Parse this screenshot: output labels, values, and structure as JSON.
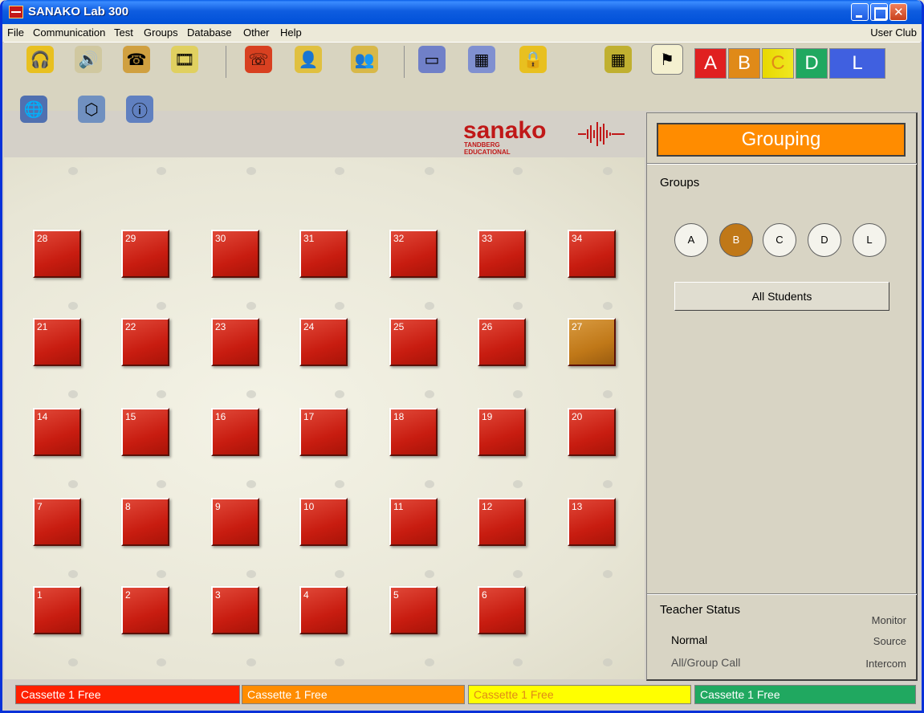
{
  "window": {
    "title": "SANAKO Lab 300"
  },
  "menu": {
    "items": [
      "File",
      "Communication",
      "Test",
      "Groups",
      "Database",
      "Other",
      "Help"
    ],
    "right": "User Club"
  },
  "toolbar": {
    "icons": [
      "headset-icon",
      "speaker-icon",
      "phone-icon",
      "film-icon",
      "telephone-icon",
      "student-icon",
      "students-group-icon",
      "monitor-icon",
      "calendar-icon",
      "lock-icon",
      "grid-icon",
      "grouping-icon"
    ],
    "secondary_icons": [
      "globe-icon",
      "box-icon",
      "info-window-icon"
    ],
    "group_tabs": [
      {
        "label": "A",
        "color": "#e02020"
      },
      {
        "label": "B",
        "color": "#e08a18"
      },
      {
        "label": "C",
        "color": "#e6e000"
      },
      {
        "label": "D",
        "color": "#20a860"
      },
      {
        "label": "L",
        "color": "#4060e0"
      }
    ]
  },
  "logo": {
    "brand": "sanako",
    "tagline": "TANDBERG EDUCATIONAL"
  },
  "seats": [
    {
      "n": "28",
      "group": "A"
    },
    {
      "n": "29",
      "group": "A"
    },
    {
      "n": "30",
      "group": "A"
    },
    {
      "n": "31",
      "group": "A"
    },
    {
      "n": "32",
      "group": "A"
    },
    {
      "n": "33",
      "group": "A"
    },
    {
      "n": "34",
      "group": "A"
    },
    {
      "n": "21",
      "group": "A"
    },
    {
      "n": "22",
      "group": "A"
    },
    {
      "n": "23",
      "group": "A"
    },
    {
      "n": "24",
      "group": "A"
    },
    {
      "n": "25",
      "group": "A"
    },
    {
      "n": "26",
      "group": "A"
    },
    {
      "n": "27",
      "group": "B"
    },
    {
      "n": "14",
      "group": "A"
    },
    {
      "n": "15",
      "group": "A"
    },
    {
      "n": "16",
      "group": "A"
    },
    {
      "n": "17",
      "group": "A"
    },
    {
      "n": "18",
      "group": "A"
    },
    {
      "n": "19",
      "group": "A"
    },
    {
      "n": "20",
      "group": "A"
    },
    {
      "n": "7",
      "group": "A"
    },
    {
      "n": "8",
      "group": "A"
    },
    {
      "n": "9",
      "group": "A"
    },
    {
      "n": "10",
      "group": "A"
    },
    {
      "n": "11",
      "group": "A"
    },
    {
      "n": "12",
      "group": "A"
    },
    {
      "n": "13",
      "group": "A"
    },
    {
      "n": "1",
      "group": "A"
    },
    {
      "n": "2",
      "group": "A"
    },
    {
      "n": "3",
      "group": "A"
    },
    {
      "n": "4",
      "group": "A"
    },
    {
      "n": "5",
      "group": "A"
    },
    {
      "n": "6",
      "group": "A"
    }
  ],
  "panel": {
    "header": "Grouping",
    "groups_label": "Groups",
    "group_buttons": [
      "A",
      "B",
      "C",
      "D",
      "L"
    ],
    "active_group": "B",
    "all_students": "All Students",
    "teacher_status_title": "Teacher Status",
    "status_left": [
      "Normal",
      "All/Group Call"
    ],
    "status_right": [
      "Monitor",
      "Source",
      "Intercom"
    ]
  },
  "statusbar": {
    "cassettes": [
      {
        "label": "Cassette 1  Free",
        "color": "#ff2000"
      },
      {
        "label": "Cassette 1  Free",
        "color": "#ff8c00"
      },
      {
        "label": "Cassette 1  Free",
        "color": "#ffff00"
      },
      {
        "label": "Cassette 1 Free",
        "color": "#20a860"
      }
    ]
  }
}
